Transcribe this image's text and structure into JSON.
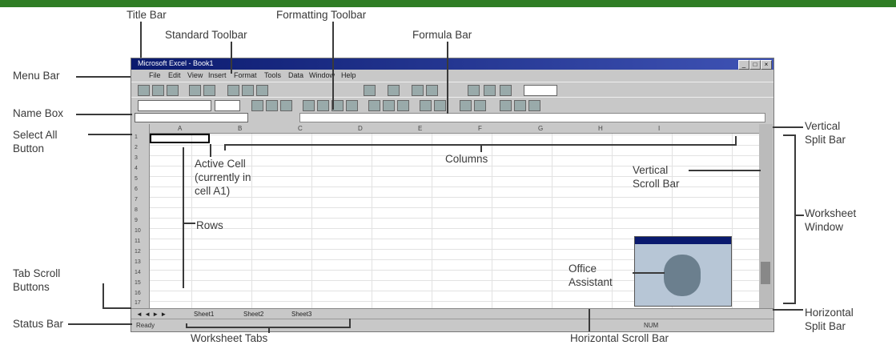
{
  "labels": {
    "title_bar": "Title Bar",
    "formatting_toolbar": "Formatting Toolbar",
    "standard_toolbar": "Standard Toolbar",
    "formula_bar": "Formula Bar",
    "menu_bar": "Menu Bar",
    "name_box": "Name Box",
    "select_all_1": "Select All",
    "select_all_2": "Button",
    "vertical_split_1": "Vertical",
    "vertical_split_2": "Split Bar",
    "active_cell_1": "Active Cell",
    "active_cell_2": "(currently in",
    "active_cell_3": "cell A1)",
    "columns": "Columns",
    "vertical_scroll_1": "Vertical",
    "vertical_scroll_2": "Scroll Bar",
    "worksheet_window_1": "Worksheet",
    "worksheet_window_2": "Window",
    "rows": "Rows",
    "office_assistant_1": "Office",
    "office_assistant_2": "Assistant",
    "tab_scroll_1": "Tab Scroll",
    "tab_scroll_2": "Buttons",
    "status_bar": "Status Bar",
    "horizontal_split_1": "Horizontal",
    "horizontal_split_2": "Split Bar",
    "worksheet_tabs": "Worksheet Tabs",
    "horizontal_scroll": "Horizontal Scroll Bar"
  },
  "window": {
    "title": "Microsoft Excel - Book1",
    "menu": [
      "File",
      "Edit",
      "View",
      "Insert",
      "Format",
      "Tools",
      "Data",
      "Window",
      "Help"
    ],
    "columns": [
      "A",
      "B",
      "C",
      "D",
      "E",
      "F",
      "G",
      "H",
      "I"
    ],
    "rows": [
      "1",
      "2",
      "3",
      "4",
      "5",
      "6",
      "7",
      "8",
      "9",
      "10",
      "11",
      "12",
      "13",
      "14",
      "15",
      "16",
      "17"
    ],
    "sheet_tabs": [
      "Sheet1",
      "Sheet2",
      "Sheet3"
    ],
    "status": "Ready",
    "status_mode": "NUM"
  },
  "colors": {
    "accent": "#2f7d25",
    "titlebar": "#0a1a6e"
  }
}
